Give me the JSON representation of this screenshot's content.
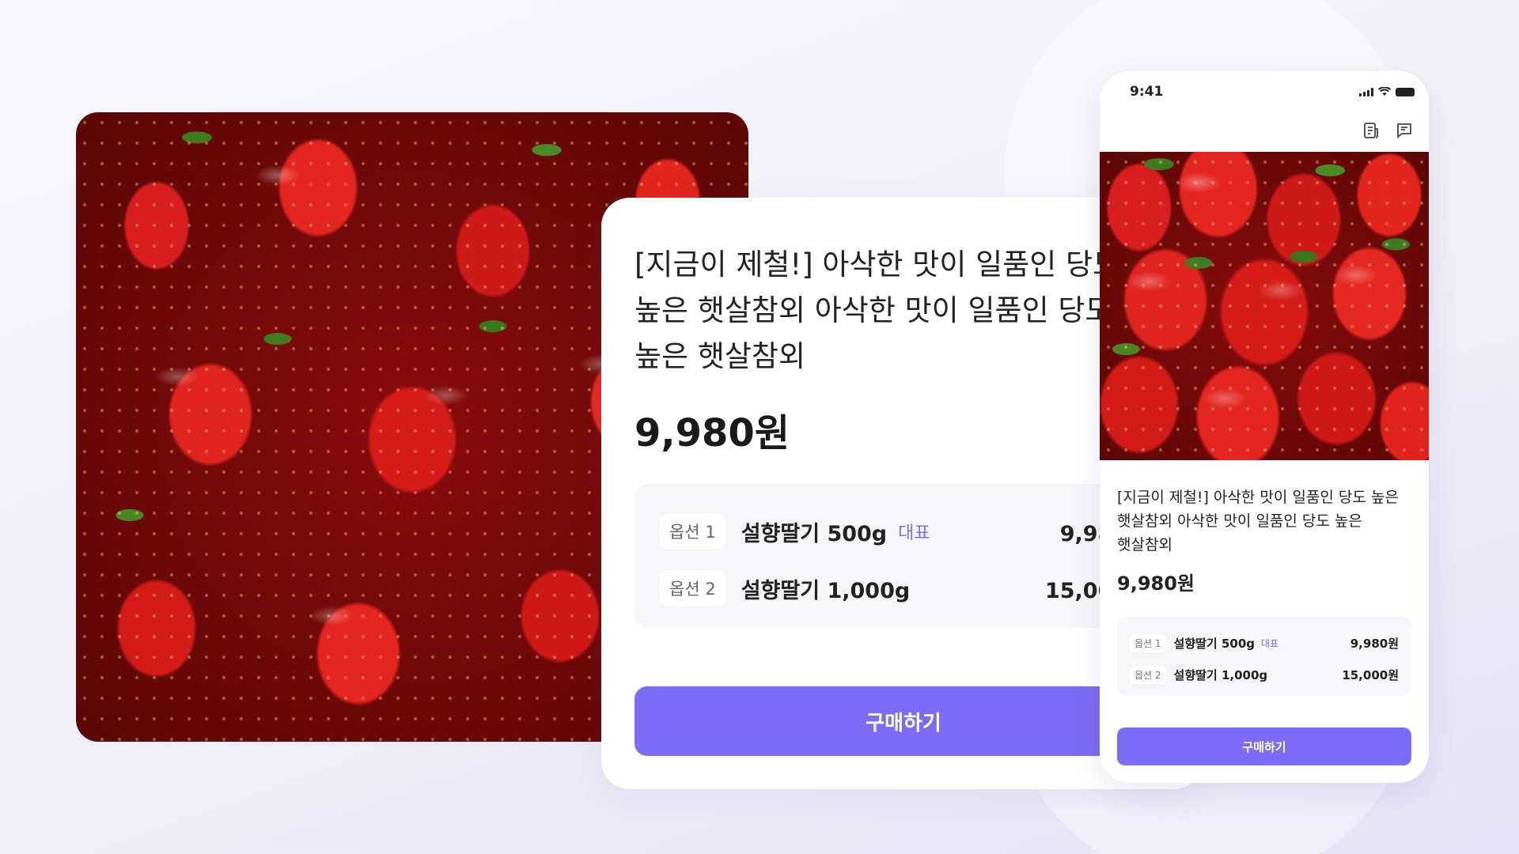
{
  "product": {
    "title": "[지금이 제철!] 아삭한 맛이 일품인 당도 높은 햇살참외 아삭한 맛이 일품인 당도 높은 햇살참외",
    "price": "9,980원",
    "image_alt": "strawberries",
    "buy_label": "구매하기"
  },
  "options": [
    {
      "tag": "옵션 1",
      "name": "설향딸기 500g",
      "badge": "대표",
      "price": "9,980원"
    },
    {
      "tag": "옵션 2",
      "name": "설향딸기 1,000g",
      "badge": "",
      "price": "15,000원"
    }
  ],
  "phone": {
    "time": "9:41",
    "icons": [
      "signal-icon",
      "wifi-icon",
      "battery-icon"
    ],
    "toolbar_icons": [
      "receipt-icon",
      "chat-question-icon"
    ]
  },
  "colors": {
    "accent": "#7b6cf5",
    "badge": "#7b6cf0",
    "option_bg": "#f6f6f9"
  }
}
